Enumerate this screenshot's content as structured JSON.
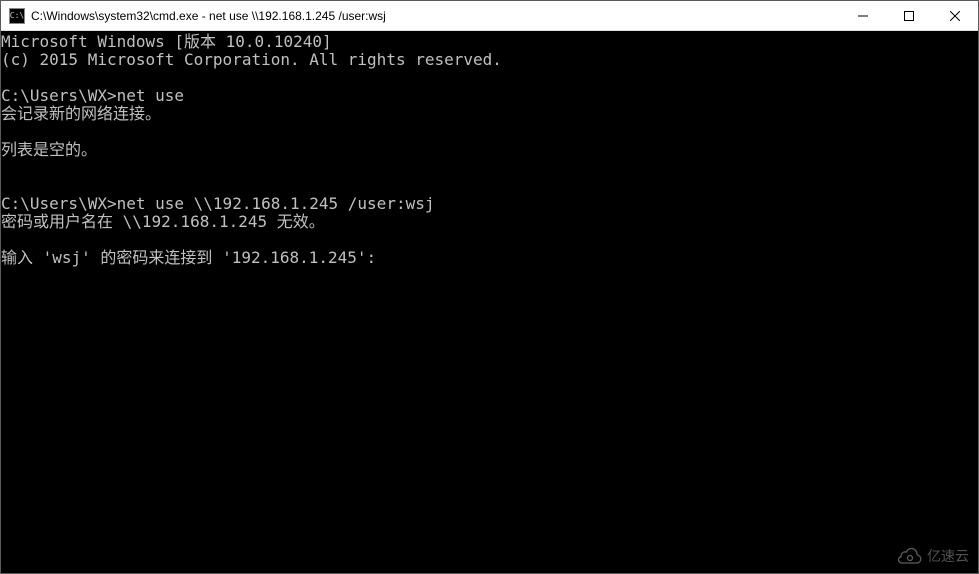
{
  "window": {
    "title": "C:\\Windows\\system32\\cmd.exe - net  use \\\\192.168.1.245 /user:wsj",
    "icon_label": "C:\\"
  },
  "terminal": {
    "lines": [
      "Microsoft Windows [版本 10.0.10240]",
      "(c) 2015 Microsoft Corporation. All rights reserved.",
      "",
      "C:\\Users\\WX>net use",
      "会记录新的网络连接。",
      "",
      "列表是空的。",
      "",
      "",
      "C:\\Users\\WX>net use \\\\192.168.1.245 /user:wsj",
      "密码或用户名在 \\\\192.168.1.245 无效。",
      "",
      "输入 'wsj' 的密码来连接到 '192.168.1.245':"
    ]
  },
  "watermark": {
    "text": "亿速云"
  }
}
